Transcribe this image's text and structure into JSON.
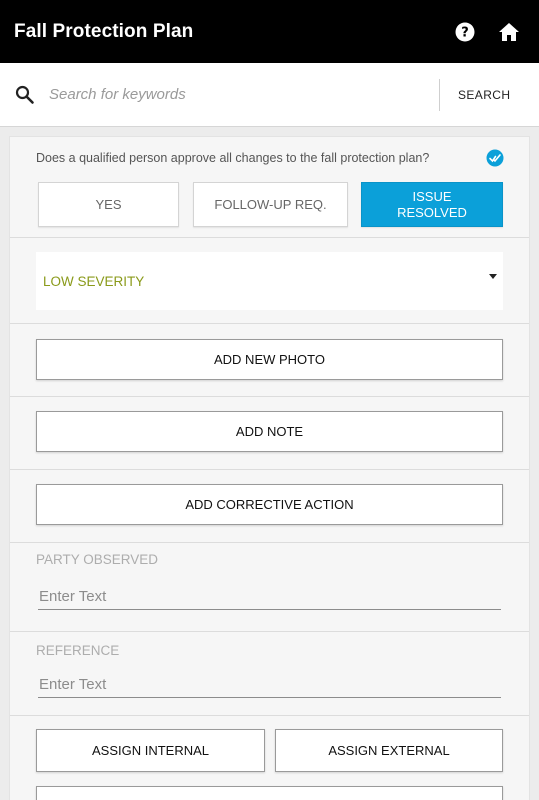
{
  "app": {
    "title": "Fall Protection Plan",
    "help_icon": "help-circle-icon",
    "home_icon": "home-icon"
  },
  "search": {
    "placeholder": "Search for keywords",
    "button_label": "SEARCH"
  },
  "question": {
    "text": "Does a qualified person approve all changes to the fall protection plan?",
    "status_icon": "check-circle-icon",
    "status_color": "#0ba0d9",
    "options": [
      "YES",
      "FOLLOW-UP REQ.",
      "ISSUE RESOLVED"
    ],
    "selected": "ISSUE RESOLVED"
  },
  "severity": {
    "value": "LOW SEVERITY",
    "color": "#8a9a1a"
  },
  "actions": {
    "add_photo": "ADD NEW PHOTO",
    "add_note": "ADD NOTE",
    "add_corrective": "ADD CORRECTIVE ACTION"
  },
  "party_observed": {
    "label": "PARTY OBSERVED",
    "placeholder": "Enter Text",
    "value": ""
  },
  "reference": {
    "label": "REFERENCE",
    "placeholder": "Enter Text",
    "value": ""
  },
  "assign": {
    "internal": "ASSIGN INTERNAL",
    "external": "ASSIGN EXTERNAL"
  },
  "colors": {
    "appbar": "#000000",
    "accent": "#0ba0d9"
  }
}
